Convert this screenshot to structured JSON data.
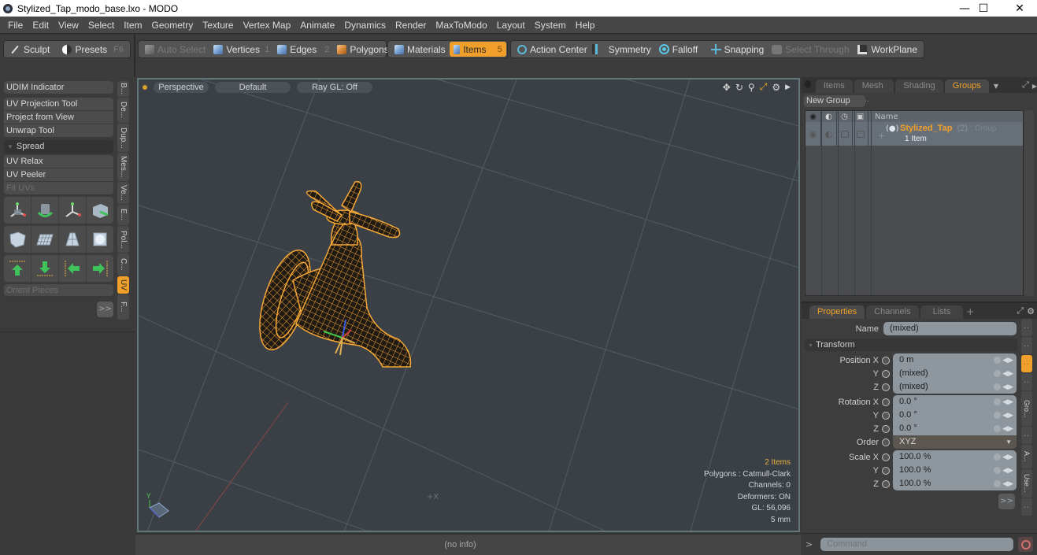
{
  "window": {
    "title": "Stylized_Tap_modo_base.lxo - MODO",
    "controls": {
      "minimize": "—",
      "maximize": "☐",
      "close": "✕"
    }
  },
  "menubar": [
    "File",
    "Edit",
    "View",
    "Select",
    "Item",
    "Geometry",
    "Texture",
    "Vertex Map",
    "Animate",
    "Dynamics",
    "Render",
    "MaxToModo",
    "Layout",
    "System",
    "Help"
  ],
  "toolbar": {
    "sculpt": "Sculpt",
    "presets": "Presets",
    "presets_key": "F6",
    "auto_select": "Auto Select",
    "vertices": "Vertices",
    "vertices_key": "1",
    "edges": "Edges",
    "edges_key": "2",
    "polygons": "Polygons",
    "materials": "Materials",
    "items": "Items",
    "items_key": "5",
    "action_center": "Action Center",
    "symmetry": "Symmetry",
    "falloff": "Falloff",
    "snapping": "Snapping",
    "select_through": "Select Through",
    "workplane": "WorkPlane"
  },
  "left_panel": {
    "buttons": {
      "udim": "UDIM Indicator",
      "uv_projection": "UV Projection Tool",
      "project_from_view": "Project from View",
      "unwrap": "Unwrap Tool",
      "spread": "Spread",
      "uv_relax": "UV Relax",
      "uv_peeler": "UV Peeler",
      "fit_uvs": "Fit UVs",
      "orient_pieces": "Orient Pieces",
      "more": ">>"
    },
    "vertical_tabs": [
      "B...",
      "De...",
      "Dup...",
      "Mes...",
      "Ve...",
      "E...",
      "Pol...",
      "C...",
      "UV",
      "F..."
    ],
    "active_tab": "UV"
  },
  "viewport": {
    "view": "Perspective",
    "shading": "Default",
    "raygl": "Ray GL: Off",
    "info": {
      "items": "2 Items",
      "polygons": "Polygons : Catmull-Clark",
      "channels": "Channels: 0",
      "deformers": "Deformers: ON",
      "gl": "GL: 56,096",
      "unit": "5 mm"
    },
    "axis_label": "Y"
  },
  "statusbar": {
    "text": "(no info)"
  },
  "groups_panel": {
    "tabs": [
      "Items",
      "Mesh ...",
      "Shading",
      "Groups"
    ],
    "active_tab": "Groups",
    "new_group": "New Group",
    "columns": {
      "name": "Name"
    },
    "rows": [
      {
        "name": "Stylized_Tap",
        "count": "(2)",
        "type": ": Group",
        "sub": "1 Item"
      }
    ]
  },
  "properties_panel": {
    "tabs": [
      "Properties",
      "Channels",
      "Lists",
      "+"
    ],
    "active_tab": "Properties",
    "name_label": "Name",
    "name_value": "(mixed)",
    "section": "Transform",
    "position": {
      "label": "Position X",
      "x": "0 m",
      "y": "(mixed)",
      "z": "(mixed)"
    },
    "rotation": {
      "label": "Rotation X",
      "x": "0.0 °",
      "y": "0.0 °",
      "z": "0.0 °"
    },
    "order": {
      "label": "Order",
      "value": "XYZ"
    },
    "scale": {
      "label": "Scale X",
      "x": "100.0 %",
      "y": "100.0 %",
      "z": "100.0 %"
    },
    "axis_labels": {
      "y": "Y",
      "z": "Z"
    },
    "more": ">>",
    "vertical_tabs": [
      ":",
      ":",
      ":",
      ":",
      "Gro...",
      ":",
      "A...",
      "Use...",
      ":"
    ]
  },
  "command": {
    "prompt": ">",
    "placeholder": "Command"
  }
}
